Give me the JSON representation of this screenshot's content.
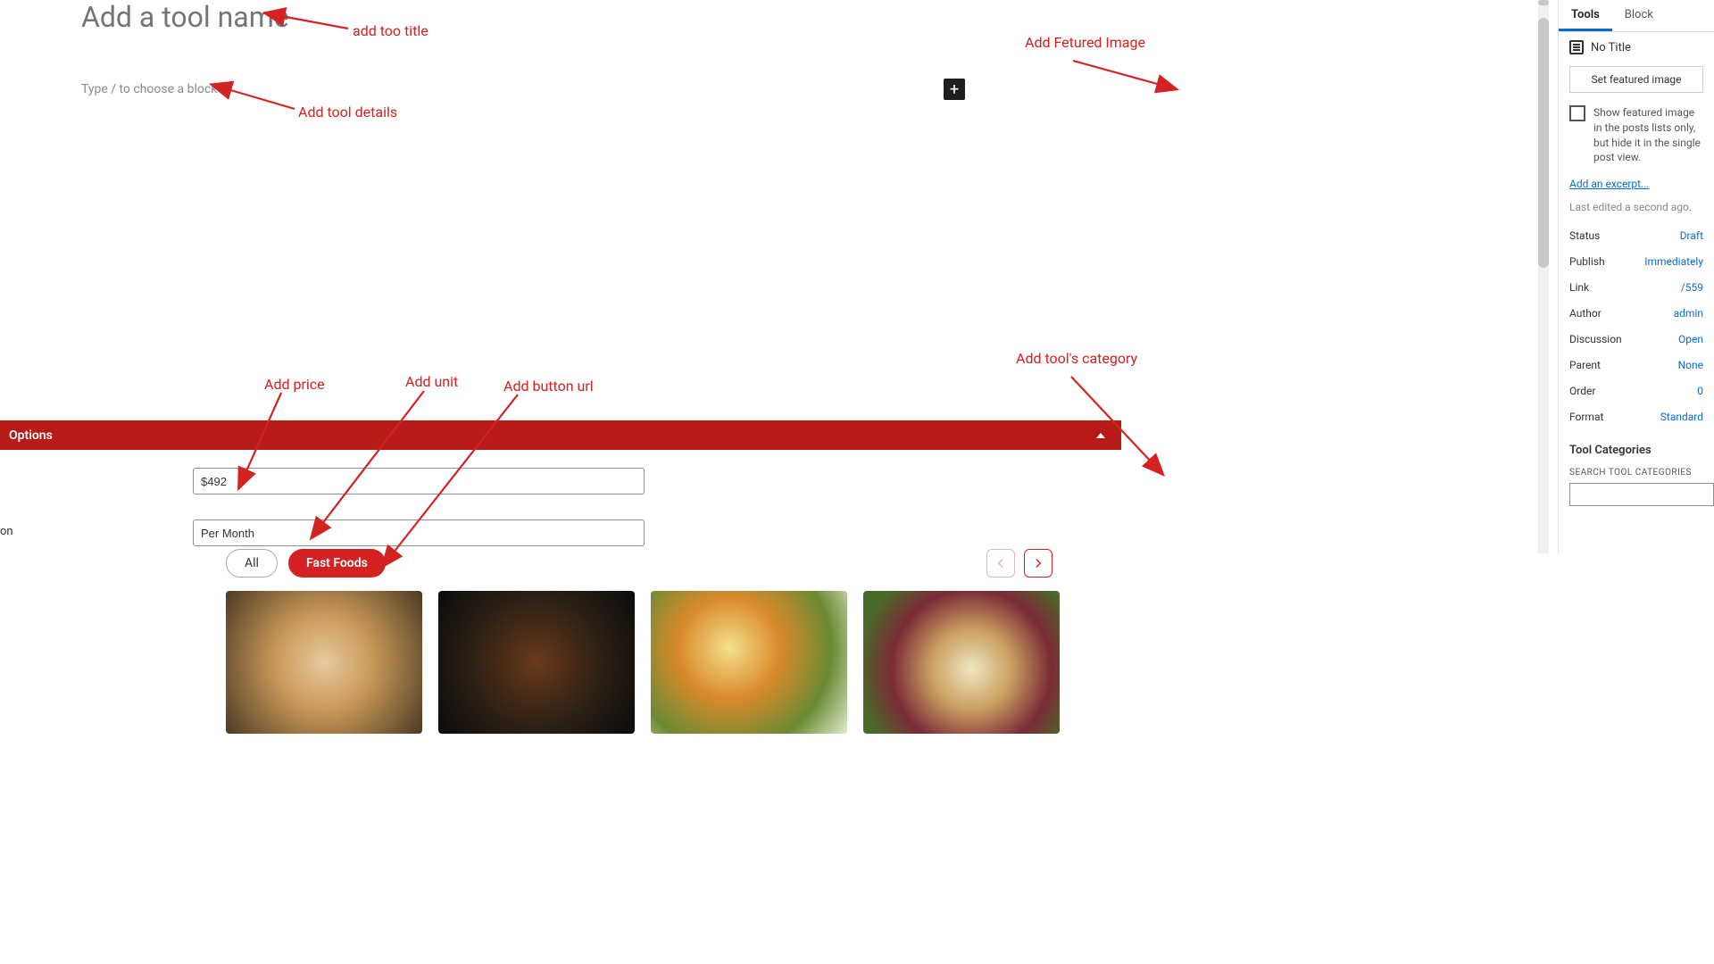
{
  "editor": {
    "title_placeholder": "Add a tool name",
    "block_placeholder": "Type / to choose a block"
  },
  "options_panel": {
    "header": "Options",
    "price_value": "$492",
    "unit_value": "Per Month",
    "side_fragment": "on"
  },
  "filters": {
    "pills": [
      "All",
      "Fast Foods"
    ],
    "active_index": 1
  },
  "sidebar": {
    "tabs": [
      "Tools",
      "Block"
    ],
    "active_tab": 0,
    "doc_title": "No Title",
    "featured_button": "Set featured image",
    "featured_checkbox_text": "Show featured image in the posts lists only, but hide it in the single post view.",
    "excerpt_link": "Add an excerpt...",
    "last_edited": "Last edited a second ago.",
    "meta": [
      {
        "k": "Status",
        "v": "Draft"
      },
      {
        "k": "Publish",
        "v": "Immediately"
      },
      {
        "k": "Link",
        "v": "/559"
      },
      {
        "k": "Author",
        "v": "admin"
      },
      {
        "k": "Discussion",
        "v": "Open"
      },
      {
        "k": "Parent",
        "v": "None"
      },
      {
        "k": "Order",
        "v": "0"
      },
      {
        "k": "Format",
        "v": "Standard"
      }
    ],
    "categories_heading": "Tool Categories",
    "categories_search_label": "SEARCH TOOL CATEGORIES"
  },
  "annotations": {
    "title": "add too title",
    "details": "Add tool details",
    "featured": "Add Fetured Image",
    "price": "Add price",
    "unit": "Add unit",
    "button_url": "Add button url",
    "category": "Add tool's category"
  }
}
